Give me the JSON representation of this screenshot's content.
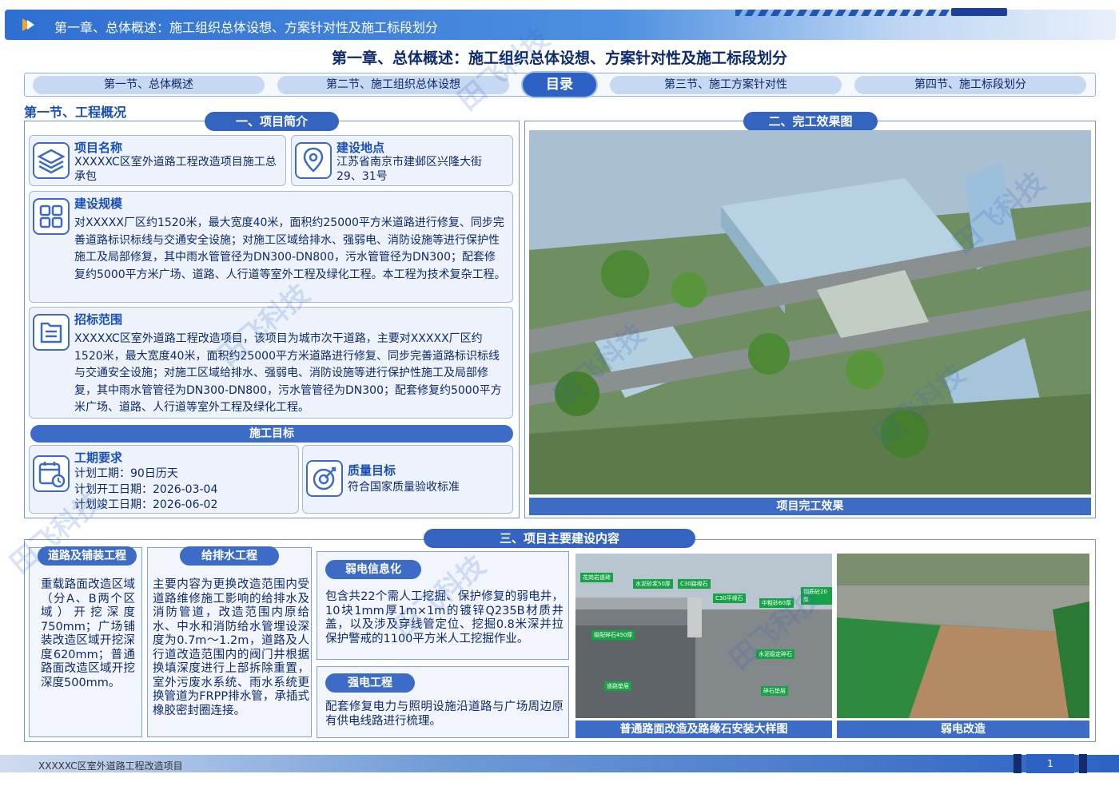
{
  "header": {
    "banner_title": "第一章、总体概述：施工组织总体设想、方案针对性及施工标段划分",
    "main_title": "第一章、总体概述：施工组织总体设想、方案针对性及施工标段划分"
  },
  "nav": {
    "tabs": [
      {
        "label": "第一节、总体概述"
      },
      {
        "label": "第二节、施工组织总体设想"
      },
      {
        "label": "第三节、施工方案针对性"
      },
      {
        "label": "第四节、施工标段划分"
      }
    ],
    "center_label": "目录"
  },
  "section_label": "第一节、工程概况",
  "intro": {
    "pill": "一、项目简介",
    "project_name": {
      "title": "项目名称",
      "text": "XXXXXC区室外道路工程改造项目施工总承包"
    },
    "location": {
      "title": "建设地点",
      "text": "江苏省南京市建邺区兴隆大街29、31号"
    },
    "scale": {
      "title": "建设规模",
      "text": "对XXXXX厂区约1520米，最大宽度40米，面积约25000平方米道路进行修复、同步完善道路标识标线与交通安全设施；对施工区域给排水、强弱电、消防设施等进行保护性施工及局部修复，其中雨水管管径为DN300-DN800，污水管管径为DN300；配套修复约5000平方米广场、道路、人行道等室外工程及绿化工程。本工程为技术复杂工程。"
    },
    "bid_scope": {
      "title": "招标范围",
      "text": "XXXXXC区室外道路工程改造项目，该项目为城市次干道路，主要对XXXXX厂区约1520米，最大宽度40米，面积约25000平方米道路进行修复、同步完善道路标识标线与交通安全设施；对施工区域给排水、强弱电、消防设施等进行保护性施工及局部修复，其中雨水管管径为DN300-DN800，污水管管径为DN300；配套修复约5000平方米广场、道路、人行道等室外工程及绿化工程。"
    },
    "target_bar": "施工目标",
    "schedule": {
      "title": "工期要求",
      "lines": [
        "计划工期：90日历天",
        "计划开工日期：2026-03-04",
        "计划竣工日期：2026-06-02"
      ]
    },
    "quality": {
      "title": "质量目标",
      "text": "符合国家质量验收标准"
    }
  },
  "effect": {
    "pill": "二、完工效果图",
    "caption": "项目完工效果"
  },
  "construction": {
    "pill": "三、项目主要建设内容",
    "road": {
      "tag": "道路及铺装工程",
      "text": "重载路面改造区域（分A、B两个区域）开挖深度750mm；广场铺装改造区域开挖深度620mm；普通路面改造区域开挖深度500mm。"
    },
    "water": {
      "tag": "给排水工程",
      "text": "主要内容为更换改造范围内受道路维修施工影响的给排水及消防管道，改造范围内原给水、中水和消防给水管埋设深度为0.7m～1.2m，道路及人行道改造范围内的阀门井根据换填深度进行上部拆除重置，室外污废水系统、雨水系统更换管道为FRPP排水管，承插式橡胶密封圈连接。"
    },
    "weak": {
      "tag": "弱电信息化",
      "text": "包含共22个需人工挖掘、保护修复的弱电井，10块1mm厚1m×1m的镀锌Q235B材质井盖，以及涉及穿线管定位、挖掘0.8米深并拉保护警戒的1100平方米人工挖掘作业。"
    },
    "strong": {
      "tag": "强电工程",
      "text": "配套修复电力与照明设施沿道路与广场周边原有供电线路进行梳理。"
    },
    "photo1_caption": "普通路面改造及路缘石安装大样图",
    "photo2_caption": "弱电改造",
    "diagram_labels": [
      "花岗岩道砖",
      "水泥砂浆50厚",
      "C30路缘石",
      "C30平缘石",
      "中粗砂60厚",
      "级配碎石450厚",
      "水泥稳定碎石",
      "道路垫层",
      "碎石垫层",
      "钢筋砼20厚"
    ]
  },
  "footer": {
    "text": "XXXXXC区室外道路工程改造项目",
    "page": "1"
  },
  "watermark": "田飞科技"
}
